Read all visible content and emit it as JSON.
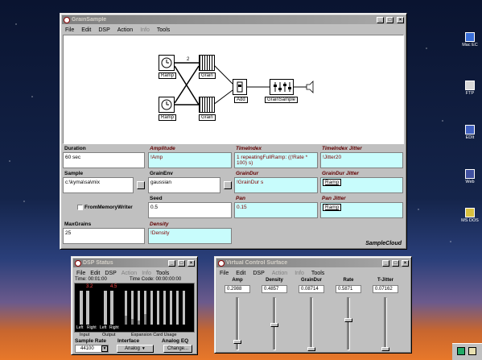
{
  "desktop": {
    "icons": [
      {
        "label": "Mac\nEC",
        "color": "#3a6fd8"
      },
      {
        "label": "FTP",
        "color": "#d8d8d8"
      },
      {
        "label": "EDIt",
        "color": "#4060c0"
      },
      {
        "label": "Web",
        "color": "#4050a0"
      },
      {
        "label": "MS\nDOS",
        "color": "#d8c040"
      }
    ]
  },
  "grain": {
    "title": "GrainSample",
    "menu": [
      "File",
      "Edit",
      "DSP",
      "Action",
      "Info",
      "Tools"
    ],
    "nodes": {
      "ramp1": "Ramp",
      "grain1": "Grain",
      "ramp2": "Ramp",
      "grain2": "Grain",
      "add": "Add",
      "sample": "GrainSample",
      "num": "2"
    },
    "fields": {
      "duration": {
        "label": "Duration",
        "value": "60 sec"
      },
      "amplitude": {
        "label": "Amplitude",
        "value": "!Amp"
      },
      "timeindex": {
        "label": "TimeIndex",
        "value": "1 repeatingFullRamp: ((!Rate * 100) s)"
      },
      "timeindexjitter": {
        "label": "TimeIndex Jitter",
        "value": "!Jitter20"
      },
      "sample": {
        "label": "Sample",
        "value": "c:\\kyma\\sa\\mix"
      },
      "grainenv": {
        "label": "GrainEnv",
        "value": "gaussian"
      },
      "graindur": {
        "label": "GrainDur",
        "value": "!GrainDur s"
      },
      "graindurjitter": {
        "label": "GrainDur Jitter",
        "value": "Ramp"
      },
      "frommemory": {
        "label": "FromMemoryWriter"
      },
      "seed": {
        "label": "Seed",
        "value": "0.5"
      },
      "pan": {
        "label": "Pan",
        "value": "0.15"
      },
      "panjitter": {
        "label": "Pan Jitter",
        "value": "Ramp"
      },
      "maxgrains": {
        "label": "MaxGrains",
        "value": "25"
      },
      "density": {
        "label": "Density",
        "value": "!Density"
      }
    },
    "footer": "SampleCloud"
  },
  "dsp": {
    "title": "DSP Status",
    "menu": [
      "File",
      "Edit",
      "DSP",
      "Action",
      "Info",
      "Tools"
    ],
    "time": "Time: 00:01:00",
    "timecode": "Time Code: 00:00:00:00",
    "meter_left": "3.2",
    "meter_right": "4.5",
    "labels": {
      "input": "Input",
      "output": "Output",
      "left": "Left",
      "right": "Right",
      "expansion": "Expansion Card Usage"
    },
    "sample_rate_label": "Sample Rate",
    "sample_rate": "44100",
    "interface_label": "Interface",
    "interface": "Analog",
    "analog_eq_label": "Analog EQ",
    "change": "Change..."
  },
  "vcs": {
    "title": "Virtual Control Surface",
    "menu": [
      "File",
      "Edit",
      "DSP",
      "Action",
      "Info",
      "Tools"
    ],
    "controls": [
      {
        "name": "Amp",
        "value": "0.2988",
        "level": 0.15
      },
      {
        "name": "Density",
        "value": "0.4857",
        "level": 0.49
      },
      {
        "name": "GrainDur",
        "value": "0.08714",
        "level": 0.0
      },
      {
        "name": "Rate",
        "value": "0.5871",
        "level": 0.59
      },
      {
        "name": "T-Jitter",
        "value": "0.07162",
        "level": 0.0
      }
    ]
  },
  "taskbar": {
    "battery_icon": "battery-icon"
  }
}
